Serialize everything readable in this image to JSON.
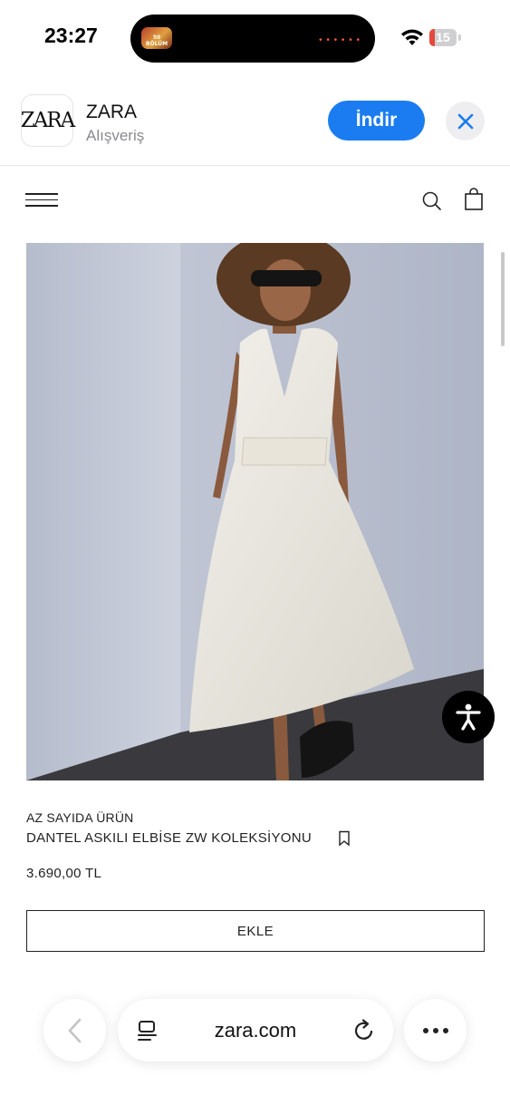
{
  "status_bar": {
    "time": "23:27",
    "live_activity_label": "50 BÖLÜM",
    "battery_level": "15",
    "battery_color": "#e5483c"
  },
  "app_banner": {
    "logo_text": "ZARA",
    "app_name": "ZARA",
    "category": "Alışveriş",
    "install_label": "İndir",
    "accent_color": "#1a7cf0"
  },
  "site_header": {
    "icons": [
      "menu-icon",
      "search-icon",
      "shopping-bag-icon"
    ]
  },
  "product": {
    "stock_label": "AZ SAYIDA ÜRÜN",
    "name": "DANTEL ASKILI ELBİSE ZW KOLEKSİYONU",
    "price": "3.690,00 TL",
    "add_label": "EKLE"
  },
  "browser": {
    "url": "zara.com",
    "icons": [
      "back-icon",
      "tabs-icon",
      "reload-icon",
      "more-icon"
    ]
  }
}
